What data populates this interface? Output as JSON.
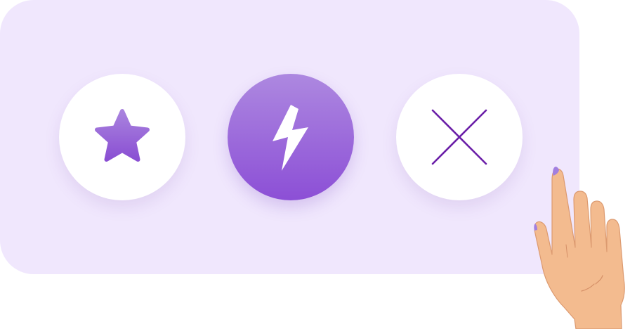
{
  "colors": {
    "panel_background": "#f0e7fd",
    "accent_gradient_top": "#ad88e0",
    "accent_gradient_bottom": "#8c4fd6",
    "close_icon_stroke": "#6b1fa8",
    "button_white": "#ffffff",
    "skin": "#f3bb8f",
    "nail": "#a27fe0"
  },
  "buttons": [
    {
      "name": "favorite",
      "icon": "star-icon",
      "style": "white"
    },
    {
      "name": "boost",
      "icon": "lightning-bolt-icon",
      "style": "purple"
    },
    {
      "name": "dismiss",
      "icon": "close-icon",
      "style": "white"
    }
  ],
  "illustration": {
    "icon": "pointing-hand-illustration"
  }
}
